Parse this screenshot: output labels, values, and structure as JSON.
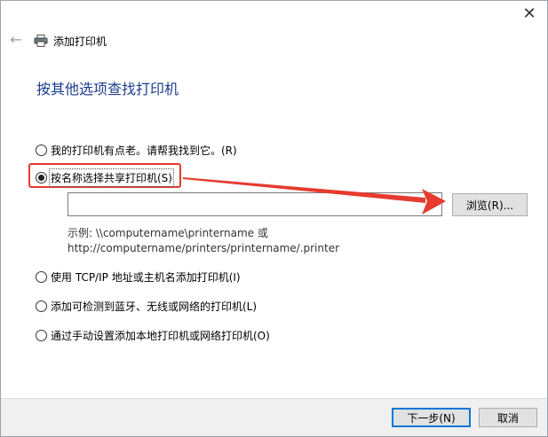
{
  "window": {
    "title": "添加打印机",
    "close_glyph": "✕",
    "back_glyph": "←"
  },
  "heading": "按其他选项查找打印机",
  "options": [
    {
      "label": "我的打印机有点老。请帮我找到它。(R)",
      "checked": false
    },
    {
      "label": "按名称选择共享打印机(S)",
      "checked": true
    },
    {
      "label": "使用 TCP/IP 地址或主机名添加打印机(I)",
      "checked": false
    },
    {
      "label": "添加可检测到蓝牙、无线或网络的打印机(L)",
      "checked": false
    },
    {
      "label": "通过手动设置添加本地打印机或网络打印机(O)",
      "checked": false
    }
  ],
  "share_input": {
    "value": "",
    "placeholder": ""
  },
  "browse_button": "浏览(R)...",
  "example": {
    "line1": "示例: \\\\computername\\printername 或",
    "line2": "http://computername/printers/printername/.printer"
  },
  "footer": {
    "next_label": "下一步(N)",
    "cancel_label": "取消"
  },
  "colors": {
    "heading": "#1c3d8f",
    "highlight": "#e63b2e",
    "primary_border": "#0078d7"
  },
  "icons": {
    "printer": "printer-icon",
    "back": "back-arrow-icon",
    "close": "close-icon"
  }
}
